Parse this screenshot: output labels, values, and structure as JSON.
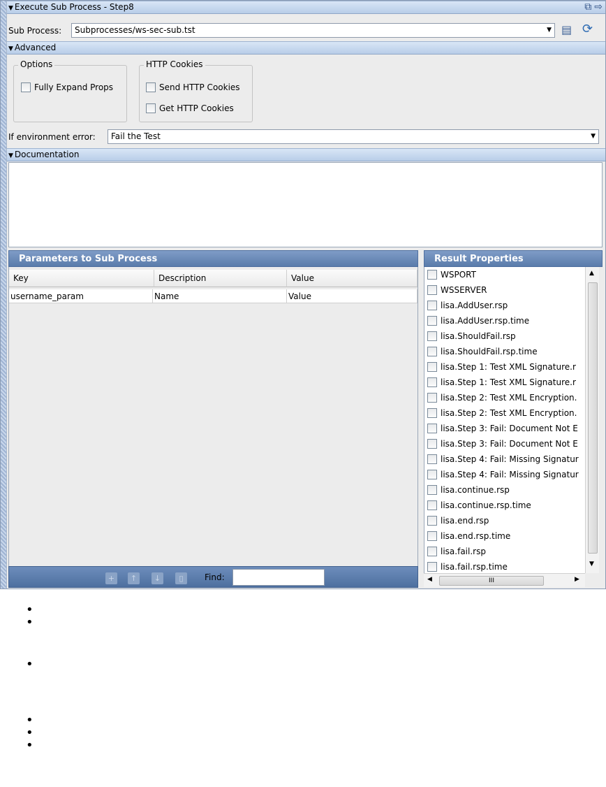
{
  "panel": {
    "title": "Execute Sub Process - Step8",
    "subprocess_label": "Sub Process:",
    "subprocess_value": "Subprocesses/ws-sec-sub.tst",
    "advanced_header": "Advanced",
    "options_legend": "Options",
    "fully_expand_label": "Fully Expand Props",
    "cookies_legend": "HTTP Cookies",
    "send_cookies_label": "Send HTTP Cookies",
    "get_cookies_label": "Get HTTP Cookies",
    "env_error_label": "If environment error:",
    "env_error_value": "Fail the Test",
    "documentation_header": "Documentation"
  },
  "params": {
    "header": "Parameters to Sub Process",
    "columns": [
      "Key",
      "Description",
      "Value"
    ],
    "rows": [
      [
        "username_param",
        "Name",
        "Value"
      ]
    ],
    "find_label": "Find:",
    "find_value": ""
  },
  "results": {
    "header": "Result Properties",
    "items": [
      "WSPORT",
      "WSSERVER",
      "lisa.AddUser.rsp",
      "lisa.AddUser.rsp.time",
      "lisa.ShouldFail.rsp",
      "lisa.ShouldFail.rsp.time",
      "lisa.Step 1: Test XML Signature.r",
      "lisa.Step 1: Test XML Signature.r",
      "lisa.Step 2: Test XML Encryption.",
      "lisa.Step 2: Test XML Encryption.",
      "lisa.Step 3: Fail: Document Not E",
      "lisa.Step 3: Fail: Document Not E",
      "lisa.Step 4: Fail: Missing Signatur",
      "lisa.Step 4: Fail: Missing Signatur",
      "lisa.continue.rsp",
      "lisa.continue.rsp.time",
      "lisa.end.rsp",
      "lisa.end.rsp.time",
      "lisa.fail.rsp",
      "lisa.fail.rsp.time"
    ],
    "hscroll_grip": "III"
  },
  "icons": {
    "triangle": "▼",
    "dropdown": "▼",
    "scroll_up": "▲",
    "scroll_down": "▼",
    "scroll_left": "◀",
    "scroll_right": "▶",
    "restore": "⧉",
    "detach": "⇨",
    "open_file": "▤",
    "refresh": "⟳",
    "add": "+",
    "move_up": "↑",
    "move_down": "↓",
    "delete": "▯",
    "bullet": "•"
  }
}
